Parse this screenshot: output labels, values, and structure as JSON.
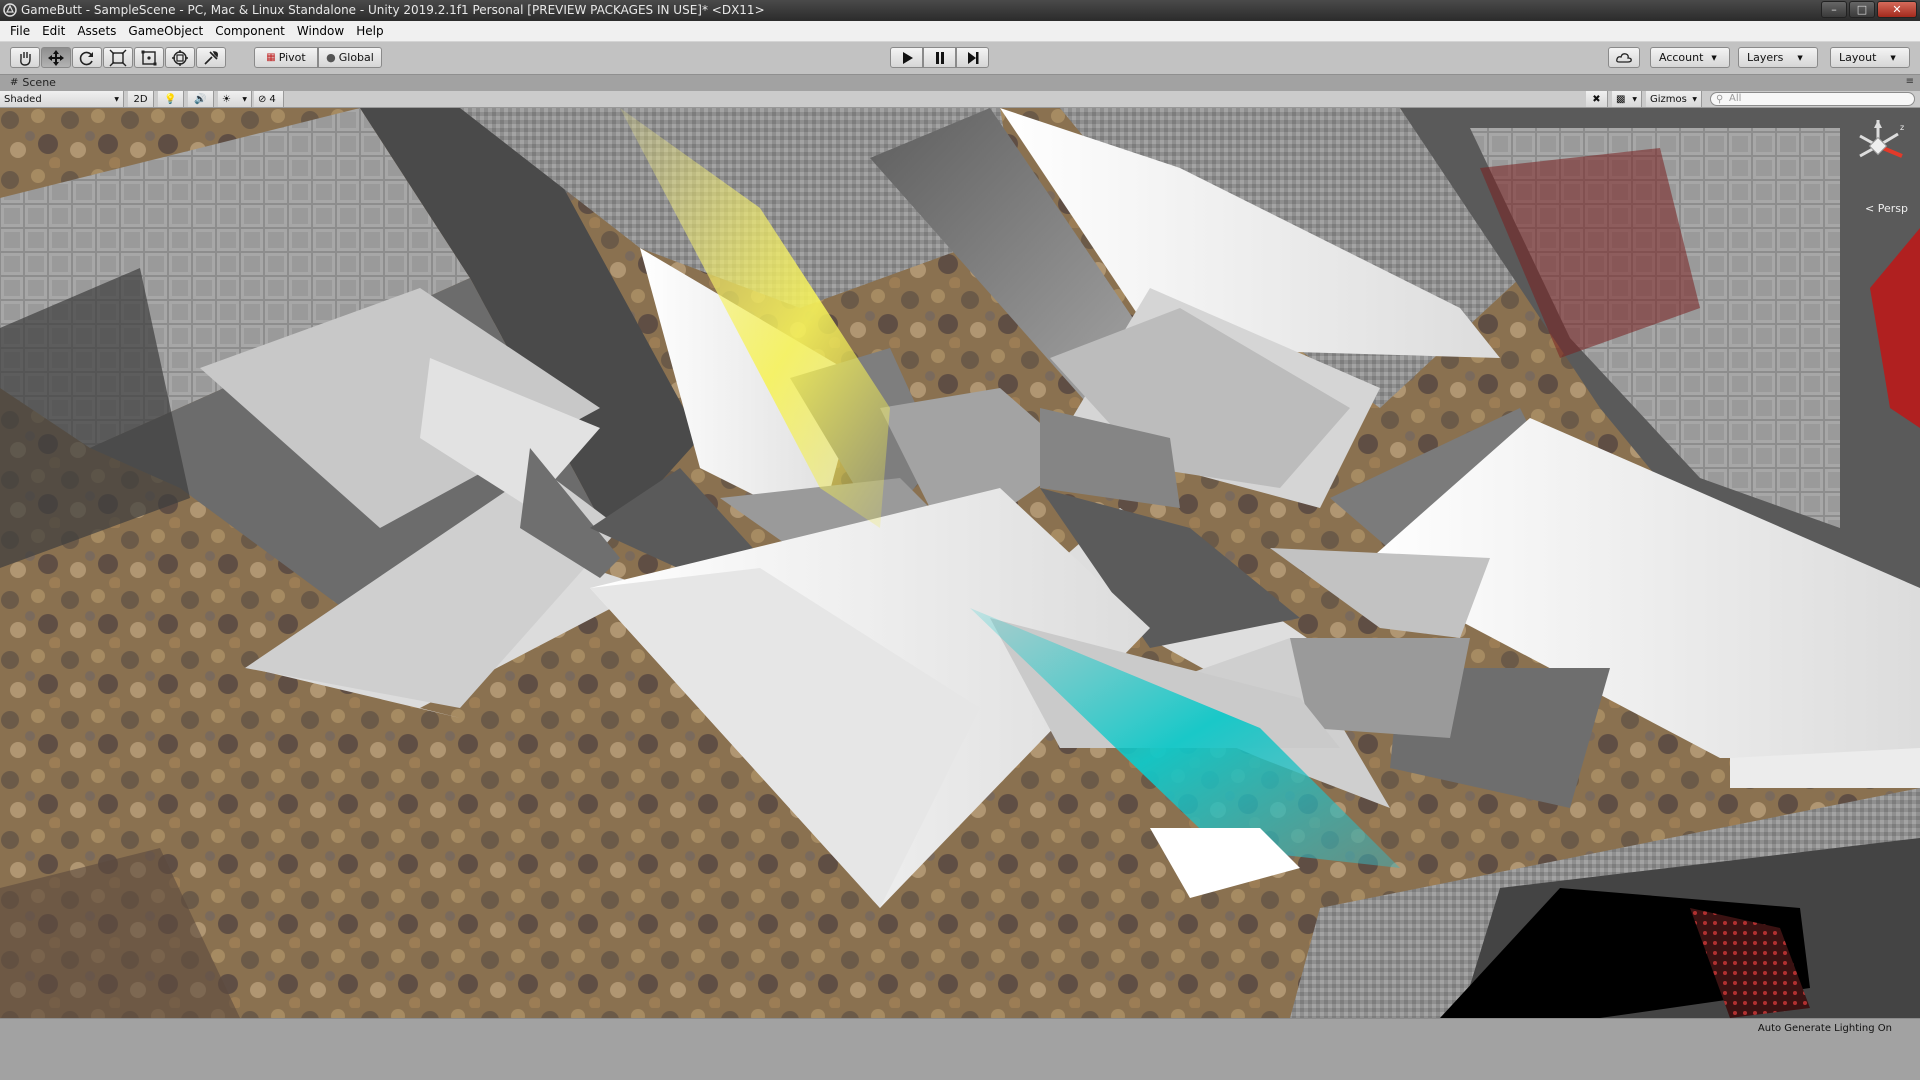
{
  "window": {
    "title": "GameButt - SampleScene - PC, Mac & Linux Standalone - Unity 2019.2.1f1 Personal [PREVIEW PACKAGES IN USE]* <DX11>",
    "controls": [
      "minimize",
      "maximize",
      "close"
    ]
  },
  "menu": [
    "File",
    "Edit",
    "Assets",
    "GameObject",
    "Component",
    "Window",
    "Help"
  ],
  "toolbar": {
    "tools": [
      "hand-tool",
      "move-tool",
      "rotate-tool",
      "scale-tool",
      "rect-tool",
      "transform-tool",
      "custom-tool"
    ],
    "pivot_label": "Pivot",
    "global_label": "Global",
    "playback": [
      "play",
      "pause",
      "step"
    ],
    "account_label": "Account",
    "layers_label": "Layers",
    "layout_label": "Layout"
  },
  "scene_tab": {
    "label": "Scene"
  },
  "scene_toolbar": {
    "shading_mode": "Shaded",
    "twod_label": "2D",
    "hidden_count": "4",
    "gizmos_label": "Gizmos",
    "search_placeholder": "All"
  },
  "viewport": {
    "projection_label": "< Persp"
  },
  "status": {
    "message": "Auto Generate Lighting On"
  }
}
